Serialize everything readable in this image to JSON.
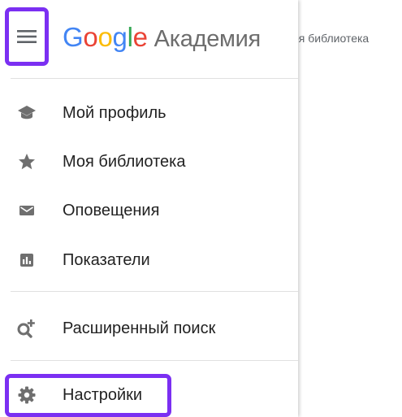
{
  "background": {
    "breadcrumb_text": "оя библиотека"
  },
  "header": {
    "menu_icon": "hamburger-menu-icon",
    "logo": {
      "letters": [
        "G",
        "o",
        "o",
        "g",
        "l",
        "e"
      ],
      "letter_colors": [
        "#4285f4",
        "#ea4335",
        "#fbbc05",
        "#4285f4",
        "#34a853",
        "#ea4335"
      ],
      "product": "Академия"
    }
  },
  "nav": {
    "primary": [
      {
        "label": "Мой профиль",
        "icon": "graduation-cap-icon"
      },
      {
        "label": "Моя библиотека",
        "icon": "star-icon"
      },
      {
        "label": "Оповещения",
        "icon": "envelope-icon"
      },
      {
        "label": "Показатели",
        "icon": "bar-chart-icon"
      }
    ],
    "secondary": [
      {
        "label": "Расширенный поиск",
        "icon": "advanced-search-icon"
      }
    ],
    "tertiary": [
      {
        "label": "Настройки",
        "icon": "gear-icon"
      }
    ]
  },
  "colors": {
    "highlight": "#7b2ff2",
    "icon": "#6f6f6f",
    "text": "#222222",
    "divider": "#e0e0e0"
  }
}
